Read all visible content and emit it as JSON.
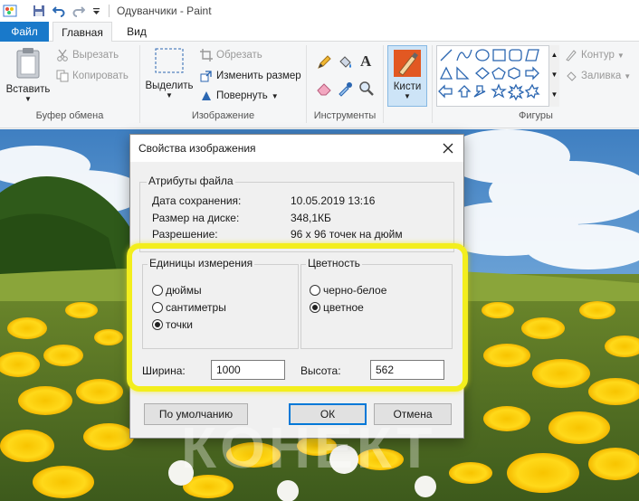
{
  "window": {
    "title": "Одуванчики - Paint"
  },
  "tabs": [
    "Файл",
    "Главная",
    "Вид"
  ],
  "ribbon": {
    "clipboard": {
      "paste": "Вставить",
      "cut": "Вырезать",
      "copy": "Копировать",
      "label": "Буфер обмена"
    },
    "image": {
      "select": "Выделить",
      "crop": "Обрезать",
      "resize": "Изменить размер",
      "rotate": "Повернуть",
      "label": "Изображение"
    },
    "tools": {
      "label": "Инструменты"
    },
    "brushes": {
      "label": "Кисти"
    },
    "shapes": {
      "outline": "Контур",
      "fill": "Заливка",
      "label": "Фигуры"
    }
  },
  "dialog": {
    "title": "Свойства изображения",
    "file_attrs": {
      "legend": "Атрибуты файла",
      "saved_label": "Дата сохранения:",
      "saved_value": "10.05.2019 13:16",
      "size_label": "Размер на диске:",
      "size_value": "348,1КБ",
      "res_label": "Разрешение:",
      "res_value": "96 x 96 точек на дюйм"
    },
    "units": {
      "legend": "Единицы измерения",
      "options": [
        "дюймы",
        "сантиметры",
        "точки"
      ],
      "selected": "точки"
    },
    "color": {
      "legend": "Цветность",
      "options": [
        "черно-белое",
        "цветное"
      ],
      "selected": "цветное"
    },
    "width_label": "Ширина:",
    "width_value": "1000",
    "height_label": "Высота:",
    "height_value": "562",
    "buttons": {
      "default": "По умолчанию",
      "ok": "ОК",
      "cancel": "Отмена"
    }
  },
  "watermark": "КОНЕКТ",
  "colors": {
    "accent": "#1979ca",
    "highlight": "#f3ee1d"
  }
}
